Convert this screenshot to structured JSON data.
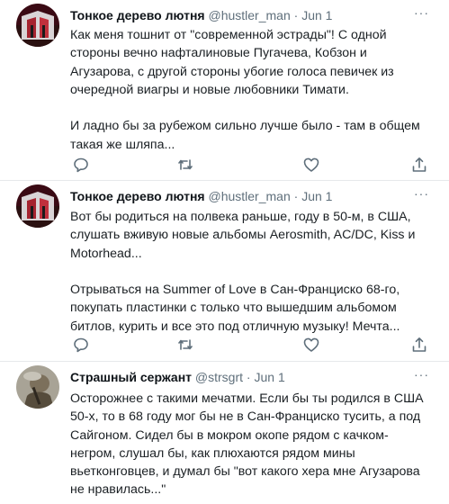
{
  "tweets": [
    {
      "name": "Тонкое дерево лютня",
      "handle": "@hustler_man",
      "separator": "·",
      "date": "Jun 1",
      "more": "···",
      "text": "Как меня тошнит от \"современной эстрады\"! С одной стороны вечно нафталиновые Пугачева, Кобзон и Агузарова, с другой стороны убогие голоса певичек из очередной виагры и новые любовники Тимати.\n\nИ ладно бы за рубежом сильно лучше было - там в общем такая же шляпа..."
    },
    {
      "name": "Тонкое дерево лютня",
      "handle": "@hustler_man",
      "separator": "·",
      "date": "Jun 1",
      "more": "···",
      "text": "Вот бы родиться на полвека раньше, году в 50-м, в США, слушать вживую новые альбомы Aerosmith, AC/DC, Kiss и Motorhead...\n\nОтрываться на Summer of Love в Сан-Франциско 68-го, покупать пластинки с только что вышедшим альбомом битлов, курить и все это под отличную музыку! Мечта..."
    },
    {
      "name": "Страшный сержант",
      "handle": "@strsgrt",
      "separator": "·",
      "date": "Jun 1",
      "more": "···",
      "text": "Осторожнее с такими мечатми. Если бы ты родился в США 50-х, то в 68 году мог бы не в Сан-Франциско тусить, а под Сайгоном. Сидел бы в мокром окопе рядом с качком-негром, слушал бы, как плюхаются рядом мины вьетконговцев, и думал бы \"вот какого хера мне Агузарова не нравилась...\""
    }
  ],
  "icons": {
    "reply": "comment-bubble-icon",
    "retweet": "retweet-arrows-icon",
    "like": "heart-outline-icon",
    "share": "share-upload-icon",
    "more": "three-dots-icon"
  },
  "colors": {
    "muted": "#5f6f7b",
    "text": "#0f1419",
    "divider": "#e6e9eb"
  }
}
